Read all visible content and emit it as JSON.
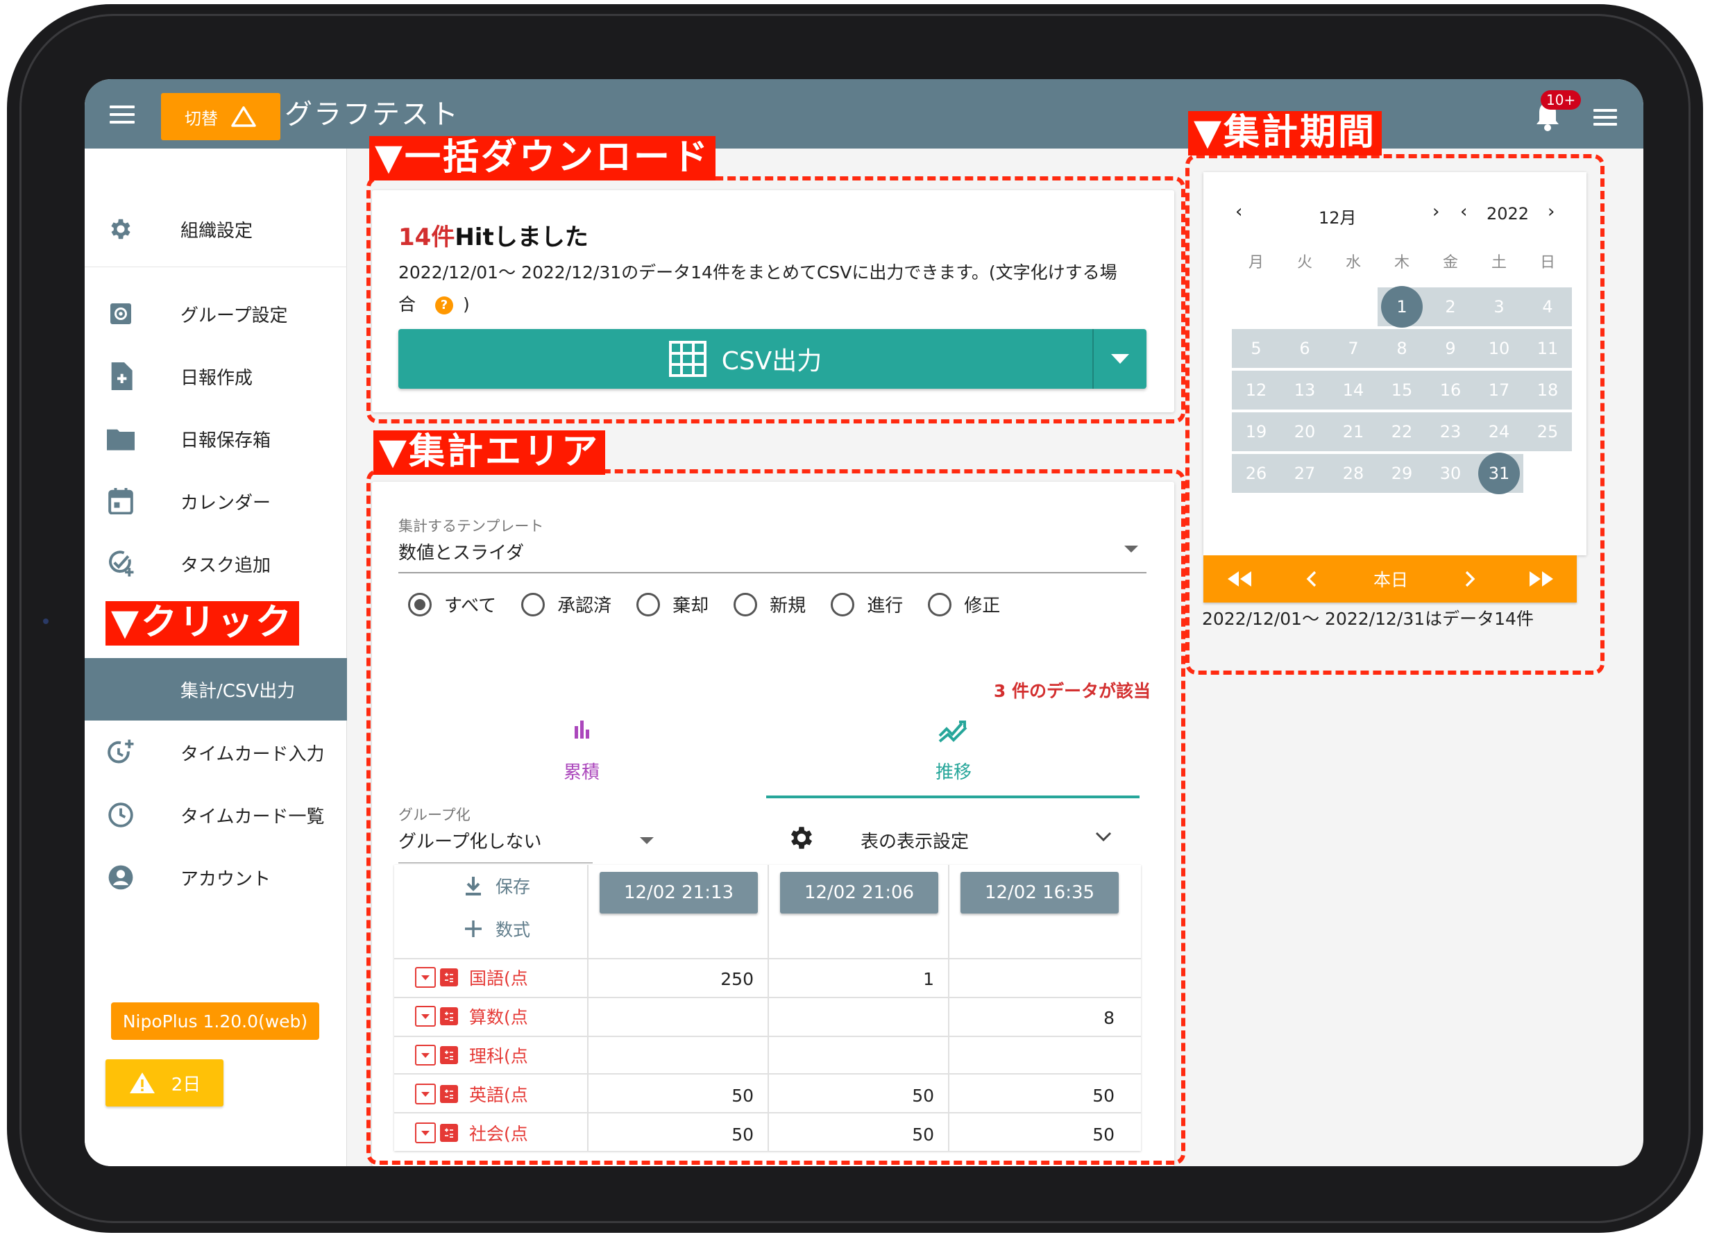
{
  "appbar": {
    "switch_label": "切替",
    "title": "グラフテスト",
    "notification_badge": "10+"
  },
  "sidebar": {
    "items": [
      {
        "label": "組織設定",
        "icon": "gear-icon"
      },
      {
        "label": "グループ設定",
        "icon": "group-settings-icon"
      },
      {
        "label": "日報作成",
        "icon": "new-document-icon"
      },
      {
        "label": "日報保存箱",
        "icon": "folder-icon"
      },
      {
        "label": "カレンダー",
        "icon": "calendar-icon"
      },
      {
        "label": "タスク追加",
        "icon": "add-task-icon"
      },
      {
        "label": "集計/CSV出力",
        "icon": "",
        "active": true
      },
      {
        "label": "タイムカード入力",
        "icon": "add-clock-icon"
      },
      {
        "label": "タイムカード一覧",
        "icon": "clock-icon"
      },
      {
        "label": "アカウント",
        "icon": "account-icon"
      }
    ],
    "version": "NipoPlus 1.20.0(web)",
    "warning": "2日"
  },
  "annotations": {
    "bulk_download": "▼一括ダウンロード",
    "aggregation_area": "▼集計エリア",
    "aggregation_period": "▼集計期間",
    "click": "▼クリック"
  },
  "download": {
    "hit_count": "14件",
    "hit_suffix": "Hitしました",
    "description": "2022/12/01～ 2022/12/31のデータ14件をまとめてCSVに出力できます。(文字化けする場合",
    "description_tail": ")",
    "help_mark": "?",
    "csv_button": "CSV出力"
  },
  "aggregation": {
    "template_label": "集計するテンプレート",
    "template_value": "数値とスライダ",
    "filters": [
      "すべて",
      "承認済",
      "棄却",
      "新規",
      "進行",
      "修正"
    ],
    "selected_filter": "すべて",
    "matched": "3 件のデータが該当",
    "tabs": [
      {
        "label": "累積",
        "icon": "bar-chart-icon"
      },
      {
        "label": "推移",
        "icon": "trend-icon"
      }
    ],
    "active_tab": "推移",
    "group_label": "グループ化",
    "group_value": "グループ化しない",
    "settings_label": "表の表示設定",
    "save_label": "保存",
    "formula_label": "数式",
    "columns": [
      "12/02 21:13",
      "12/02 21:06",
      "12/02 16:35"
    ],
    "rows": [
      {
        "name": "国語(点",
        "values": [
          "250",
          "1",
          ""
        ]
      },
      {
        "name": "算数(点",
        "values": [
          "",
          "",
          "8"
        ]
      },
      {
        "name": "理科(点",
        "values": [
          "",
          "",
          ""
        ]
      },
      {
        "name": "英語(点",
        "values": [
          "50",
          "50",
          "50"
        ]
      },
      {
        "name": "社会(点",
        "values": [
          "50",
          "50",
          "50"
        ]
      }
    ]
  },
  "calendar": {
    "month": "12月",
    "year": "2022",
    "weekdays": [
      "月",
      "火",
      "水",
      "木",
      "金",
      "土",
      "日"
    ],
    "weeks": [
      [
        "",
        "",
        "",
        "1",
        "2",
        "3",
        "4"
      ],
      [
        "5",
        "6",
        "7",
        "8",
        "9",
        "10",
        "11"
      ],
      [
        "12",
        "13",
        "14",
        "15",
        "16",
        "17",
        "18"
      ],
      [
        "19",
        "20",
        "21",
        "22",
        "23",
        "24",
        "25"
      ],
      [
        "26",
        "27",
        "28",
        "29",
        "30",
        "31",
        ""
      ]
    ],
    "selected_days": [
      "1",
      "31"
    ],
    "today_label": "本日",
    "summary": "2022/12/01～ 2022/12/31はデータ14件"
  },
  "colors": {
    "appbar": "#607d8b",
    "accent_orange": "#ff9800",
    "teal": "#26a69a",
    "annotation_red": "#ff1a00"
  }
}
